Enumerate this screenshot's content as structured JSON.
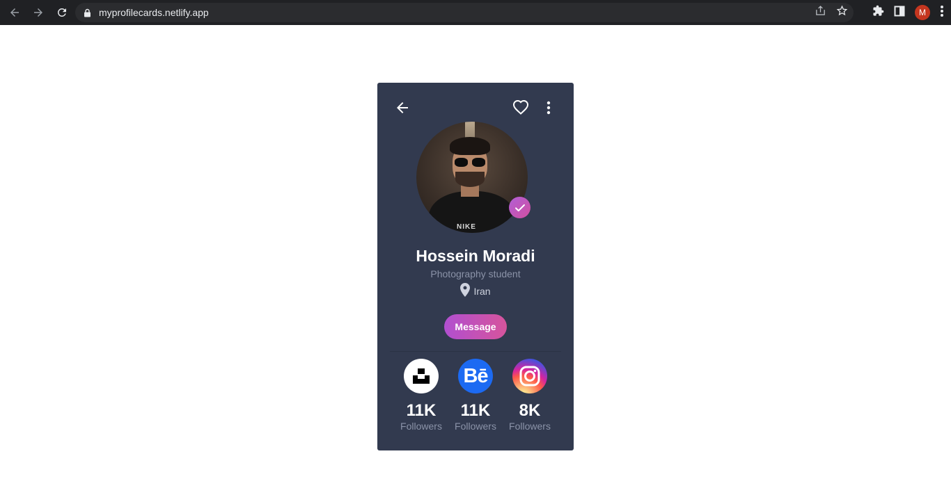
{
  "browser": {
    "url": "myprofilecards.netlify.app",
    "profile_initial": "M",
    "icons": [
      "back-arrow-icon",
      "forward-arrow-icon",
      "reload-icon",
      "lock-icon",
      "share-icon",
      "star-icon",
      "extensions-icon",
      "side-panel-icon",
      "kebab-menu-icon"
    ]
  },
  "card": {
    "name": "Hossein Moradi",
    "role": "Photography student",
    "location": "Iran",
    "message_label": "Message",
    "colors": {
      "background": "#323a4f",
      "accent_start": "#b14fd0",
      "accent_end": "#d6549c"
    },
    "photo_text": "NIKE",
    "socials": [
      {
        "network": "unsplash",
        "icon": "unsplash-icon",
        "count": "11K",
        "label": "Followers"
      },
      {
        "network": "behance",
        "icon": "behance-icon",
        "glyph": "Bē",
        "count": "11K",
        "label": "Followers"
      },
      {
        "network": "instagram",
        "icon": "instagram-icon",
        "count": "8K",
        "label": "Followers"
      }
    ]
  }
}
